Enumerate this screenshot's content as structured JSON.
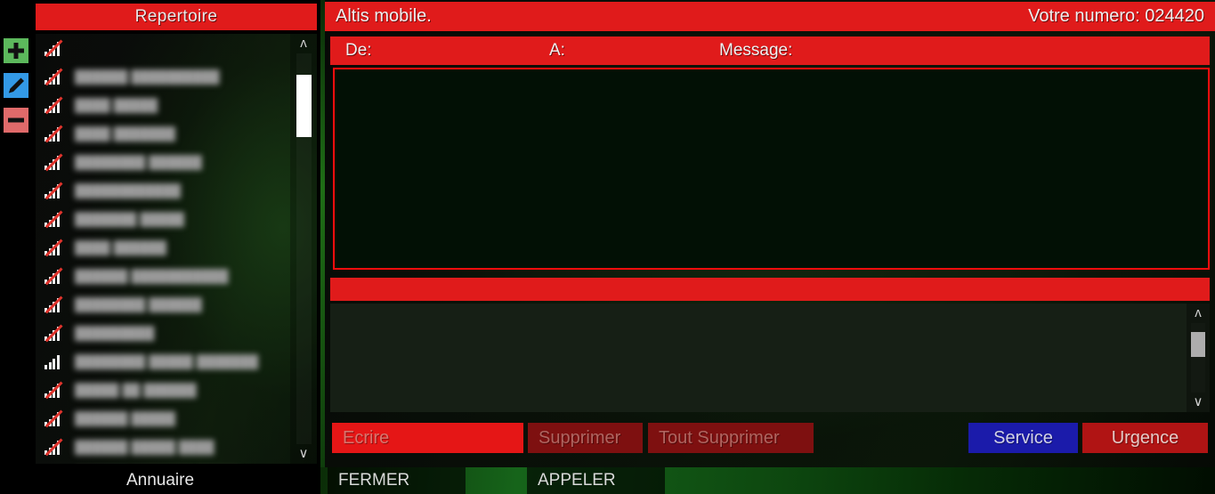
{
  "rail": {
    "add_label": "add-contact",
    "edit_label": "edit-contact",
    "remove_label": "remove-contact"
  },
  "sidebar": {
    "title": "Repertoire",
    "footer_label": "Annuaire",
    "scrollbar": {
      "up": "ʌ",
      "down": "∨"
    },
    "contacts": [
      {
        "name": "",
        "online": false
      },
      {
        "name": "██████ ██████████",
        "online": false
      },
      {
        "name": "████ █████",
        "online": false
      },
      {
        "name": "████ ███████",
        "online": false
      },
      {
        "name": "████████ ██████",
        "online": false
      },
      {
        "name": "████████████",
        "online": false
      },
      {
        "name": "███████ █████",
        "online": false
      },
      {
        "name": "████ ██████",
        "online": false
      },
      {
        "name": "██████ ███████████",
        "online": false
      },
      {
        "name": "████████ ██████",
        "online": false
      },
      {
        "name": "█████████",
        "online": false
      },
      {
        "name": "████████ █████ ███████",
        "online": true
      },
      {
        "name": "█████ ██ ██████",
        "online": false
      },
      {
        "name": "██████ █████",
        "online": false
      },
      {
        "name": "██████ █████ ████",
        "online": false
      },
      {
        "name": "██████ ███████ █████",
        "online": false
      }
    ]
  },
  "header": {
    "app_title": "Altis mobile.",
    "number_label": "Votre numero: 024420"
  },
  "message_panel": {
    "col_de": "De:",
    "col_a": "A:",
    "col_message": "Message:",
    "message_body": "",
    "red_bar_text": "",
    "conversation_text": "",
    "scrollbar": {
      "up": "ʌ",
      "down": "∨"
    }
  },
  "actions": {
    "ecrire": "Ecrire",
    "supprimer": "Supprimer",
    "tout_supprimer": "Tout Supprimer",
    "service": "Service",
    "urgence": "Urgence"
  },
  "bottom_bar": {
    "fermer": "FERMER",
    "appeler": "APPELER"
  },
  "colors": {
    "accent_red": "#e01b1b",
    "border_red": "#ff0d0d",
    "service_blue": "#1b1baa",
    "urgence_red": "#b01414",
    "add_green": "#5cb85c",
    "edit_blue": "#3399e6",
    "remove_pink": "#e06a6a",
    "signal_white": "#f2f2f2",
    "offline_slash": "#e0332c"
  }
}
